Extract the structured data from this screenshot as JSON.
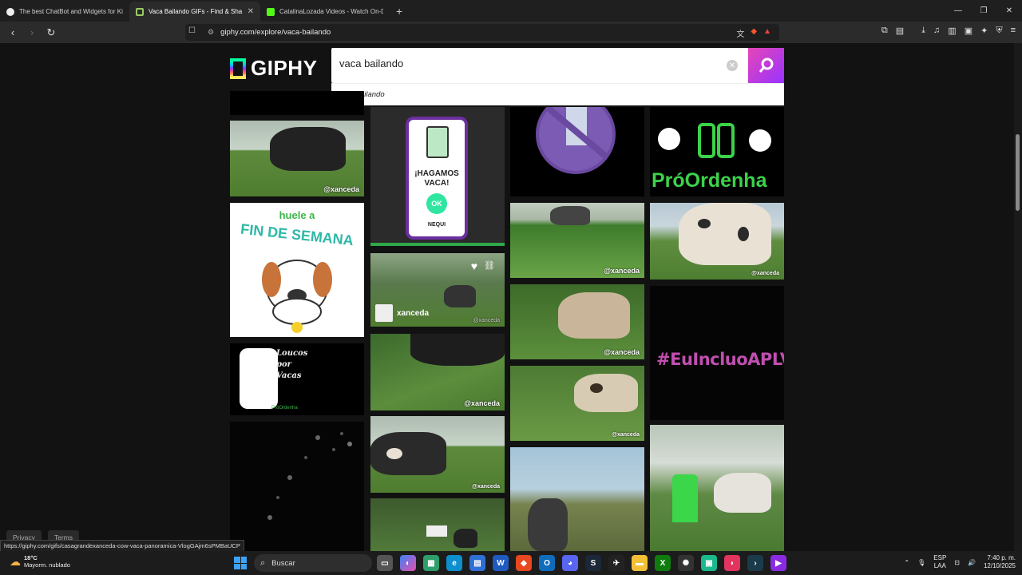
{
  "browser": {
    "tabs": [
      {
        "title": "The best ChatBot and Widgets for Ki",
        "active": false,
        "favicon_color": "#ffffff"
      },
      {
        "title": "Vaca Bailando GIFs - Find & Sha",
        "active": true,
        "favicon_color": "#ffffff"
      },
      {
        "title": "CatalinaLozada Videos - Watch On-D",
        "active": false,
        "favicon_color": "#53fc18"
      }
    ],
    "new_tab": "+",
    "url": "giphy.com/explore/vaca-bailando",
    "window_controls": {
      "minimize": "—",
      "restore": "❐",
      "close": "✕"
    }
  },
  "giphy": {
    "logo_text": "GIPHY",
    "search_value": "vaca bailando",
    "suggestion": "vaca bailando",
    "gifs": [
      {
        "tag": "@xanceda"
      },
      {
        "title": "huele a",
        "subtitle": "FIN DE SEMANA"
      },
      {
        "title": "Loucos por Vacas",
        "sub": "PróOrdenha"
      },
      {
        "title": "¡HAGAMOS VACA!",
        "button": "OK",
        "brand": "NEQUI"
      },
      {
        "channel": "xanceda",
        "tag": "@xanceda"
      },
      {
        "tag": "@xanceda"
      },
      {
        "tag": "@xanceda"
      },
      {
        "tag": "@xanceda"
      },
      {
        "tag": "@xanceda"
      },
      {
        "tag": "@xanceda"
      },
      {
        "title": "PróOrdenha"
      },
      {
        "tag": "@xanceda"
      },
      {
        "title": "#EuIncluoAPLV"
      }
    ],
    "footer": {
      "privacy": "Privacy",
      "terms": "Terms"
    },
    "status_url": "https://giphy.com/gifs/casagrandexanceda-cow-vaca-panoramica-VlogGAjm6sPMBaUCP"
  },
  "taskbar": {
    "weather_temp": "18°C",
    "weather_desc": "Mayorm. nublado",
    "search_placeholder": "Buscar",
    "lang": "ESP",
    "lang2": "LAA",
    "time": "7:40 p. m.",
    "date": "12/10/2025"
  }
}
